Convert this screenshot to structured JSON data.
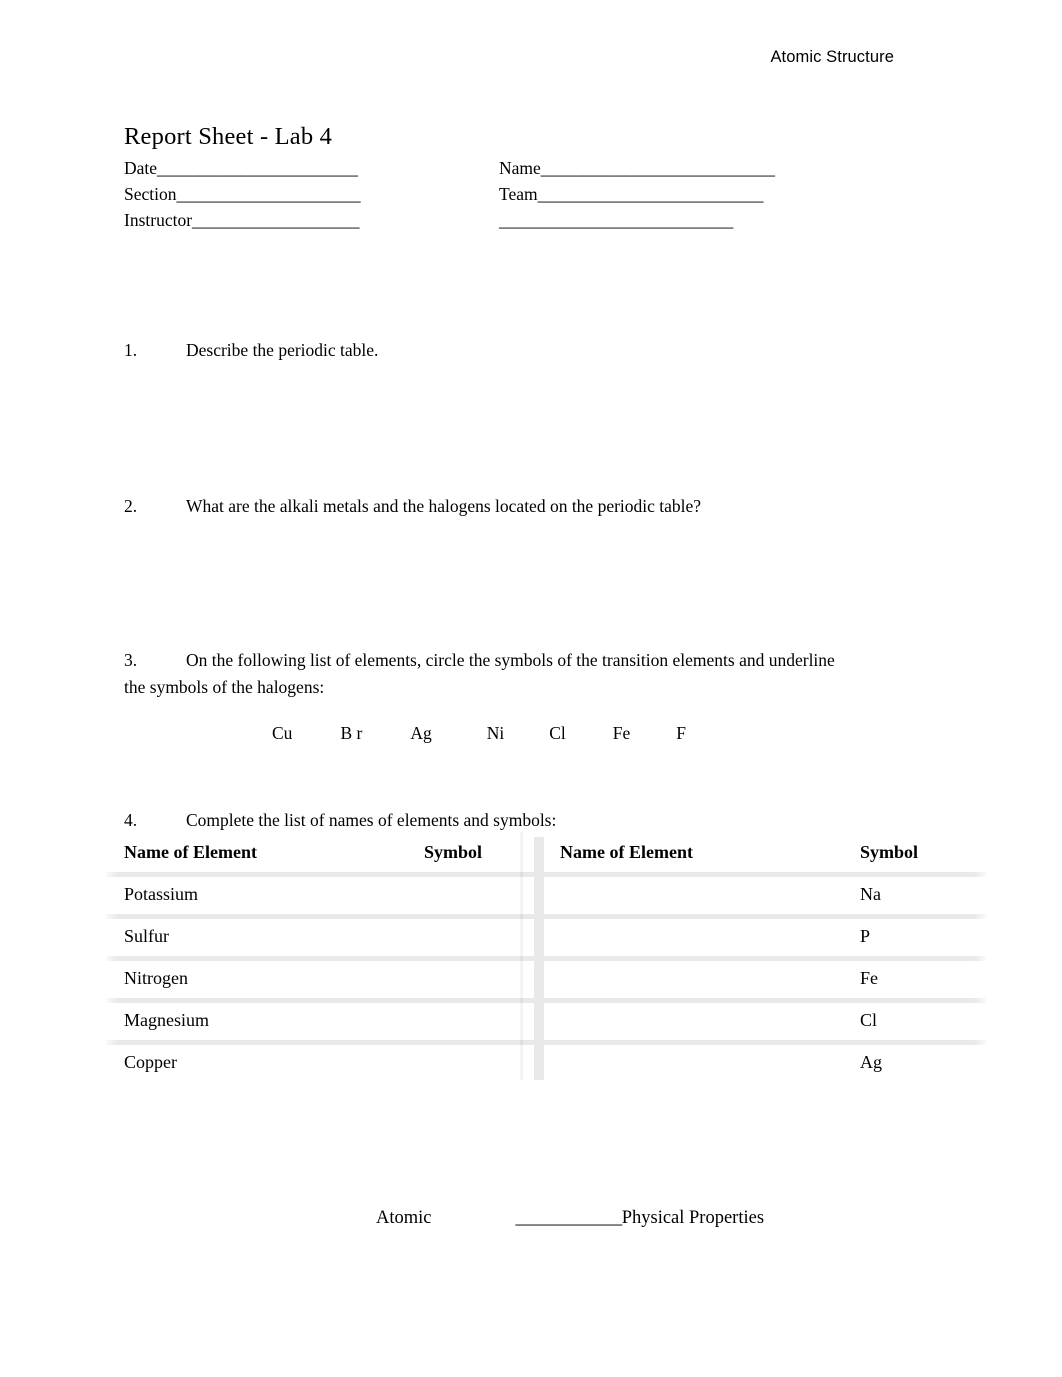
{
  "header": {
    "running_head": "Atomic Structure"
  },
  "title": "Report Sheet - Lab 4",
  "form": {
    "rows": [
      {
        "left_label": "Date",
        "left_rule": "________________________",
        "right_label": "Name",
        "right_rule": "____________________________"
      },
      {
        "left_label": "Section",
        "left_rule": "______________________",
        "right_label": "Team",
        "right_rule": "___________________________"
      },
      {
        "left_label": "Instructor",
        "left_rule": "____________________",
        "right_label": "",
        "right_rule": "____________________________"
      }
    ]
  },
  "questions": [
    {
      "number": "1.",
      "text": "Describe the periodic table."
    },
    {
      "number": "2.",
      "text": "What are the alkali metals and the halogens located on the periodic table?"
    },
    {
      "number": "3.",
      "line1": "On the following list of elements, circle the symbols of the transition elements and underline",
      "line2": "the symbols of the halogens:"
    },
    {
      "number": "4.",
      "text": "Complete the list of names of elements and symbols:"
    }
  ],
  "element_symbols": [
    "Cu",
    "B r",
    "Ag",
    "Ni",
    "Cl",
    "Fe",
    "F"
  ],
  "table": {
    "headers": [
      "Name of Element",
      "Symbol",
      "Name of Element",
      "Symbol"
    ],
    "rows": [
      {
        "name_left": "Potassium",
        "symbol_left": "",
        "name_right": "",
        "symbol_right": "Na"
      },
      {
        "name_left": "Sulfur",
        "symbol_left": "",
        "name_right": "",
        "symbol_right": "P"
      },
      {
        "name_left": "Nitrogen",
        "symbol_left": "",
        "name_right": "",
        "symbol_right": "Fe"
      },
      {
        "name_left": "Magnesium",
        "symbol_left": "",
        "name_right": "",
        "symbol_right": "Cl"
      },
      {
        "name_left": "Copper",
        "symbol_left": "",
        "name_right": "",
        "symbol_right": "Ag"
      }
    ]
  },
  "footer": {
    "left_text": "Atomic",
    "rule": "____________",
    "right_text": "Physical Properties"
  },
  "colors": {
    "text": "#000000",
    "page_background": "#ffffff",
    "table_band": "#e9e9e9"
  }
}
